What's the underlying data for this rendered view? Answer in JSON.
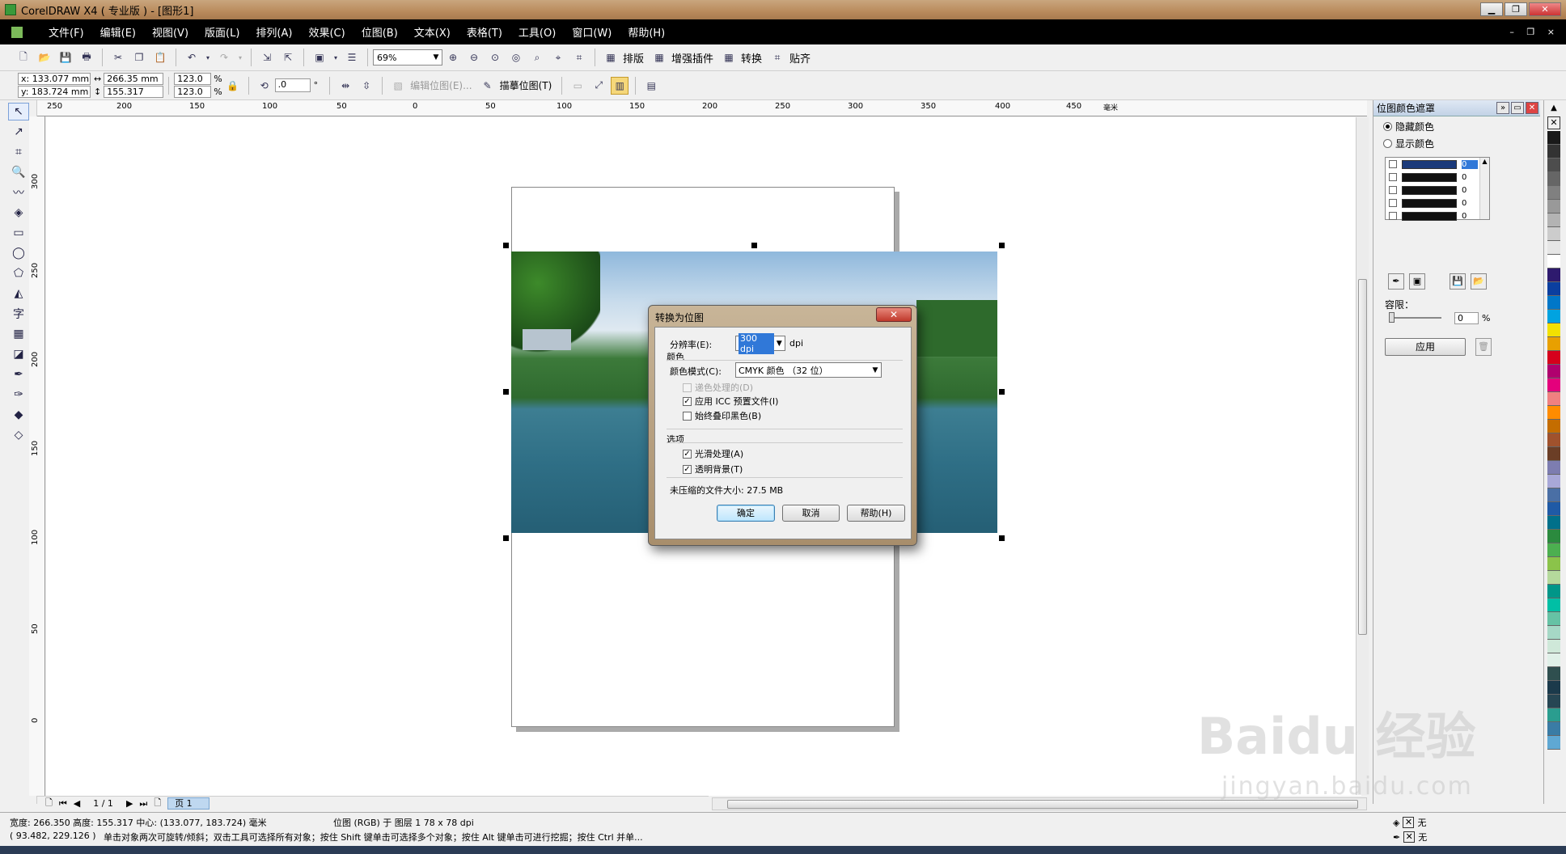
{
  "window": {
    "title": "CorelDRAW X4 ( 专业版 ) - [图形1]",
    "min": "▁",
    "max": "❐",
    "close": "✕"
  },
  "menu": {
    "items": [
      "文件(F)",
      "编辑(E)",
      "视图(V)",
      "版面(L)",
      "排列(A)",
      "效果(C)",
      "位图(B)",
      "文本(X)",
      "表格(T)",
      "工具(O)",
      "窗口(W)",
      "帮助(H)"
    ],
    "doc_controls": "– ❐ ×"
  },
  "toolbar1": {
    "zoom": "69%",
    "layout_label": "排版",
    "plugin_label": "增强插件",
    "convert_label": "转换",
    "snap_label": "贴齐"
  },
  "toolbar2": {
    "x": "x: 133.077 mm",
    "y": "y: 183.724 mm",
    "width": "266.35 mm",
    "height": "155.317 mm",
    "scale_x": "123.0",
    "scale_y": "123.0",
    "pct": "%",
    "rotation": ".0",
    "deg": "°",
    "edit_bitmap": "编辑位图(E)...",
    "trace_bitmap": "描摹位图(T)"
  },
  "ruler": {
    "h_ticks": [
      "250",
      "200",
      "150",
      "100",
      "50",
      "0",
      "50",
      "100",
      "150",
      "200",
      "250",
      "300",
      "350",
      "400",
      "450"
    ],
    "h_unit": "毫米",
    "v_ticks": [
      "300",
      "250",
      "200",
      "150",
      "100",
      "50",
      "0"
    ]
  },
  "page_nav": {
    "count": "1 / 1",
    "tab": "页 1"
  },
  "docker": {
    "title": "位图颜色遮罩",
    "hide_color": "隐藏颜色",
    "show_color": "显示颜色",
    "rows": [
      {
        "value": "0",
        "selected": true
      },
      {
        "value": "0",
        "selected": false
      },
      {
        "value": "0",
        "selected": false
      },
      {
        "value": "0",
        "selected": false
      },
      {
        "value": "0",
        "selected": false
      }
    ],
    "tolerance_label": "容限：",
    "tolerance_value": "0",
    "tolerance_unit": "%",
    "tolerance_level": 0,
    "apply": "应用"
  },
  "dialog": {
    "title": "转换为位图",
    "resolution_label": "分辨率(E):",
    "resolution_value": "300 dpi",
    "resolution_unit": "dpi",
    "color_group": "颜色",
    "color_mode_label": "颜色模式(C):",
    "color_mode_value": "CMYK 颜色 （32 位）",
    "dither": "递色处理的(D)",
    "dither_checked": false,
    "apply_icc": "应用 ICC 预置文件(I)",
    "apply_icc_checked": true,
    "overprint_black": "始终叠印黑色(B)",
    "overprint_black_checked": false,
    "options_group": "选项",
    "antialias": "光滑处理(A)",
    "antialias_checked": true,
    "transparent_bg": "透明背景(T)",
    "transparent_bg_checked": true,
    "filesize": "未压缩的文件大小: 27.5 MB",
    "ok": "确定",
    "cancel": "取消",
    "help": "帮助(H)"
  },
  "status": {
    "dims": "宽度: 266.350  高度: 155.317  中心: (133.077, 183.724)  毫米",
    "object": "位图 (RGB) 于 图层 1 78 x 78 dpi",
    "cursor": "( 93.482, 229.126 )",
    "hint": "单击对象两次可旋转/倾斜；双击工具可选择所有对象；按住 Shift 键单击可选择多个对象；按住 Alt 键单击可进行挖掘；按住 Ctrl 并单...",
    "fill": "无",
    "outline": "无"
  },
  "watermark": {
    "brand": "Baidu 经验",
    "url": "jingyan.baidu.com"
  },
  "colors": {
    "palette": [
      "#1a1a1a",
      "#333333",
      "#4d4d4d",
      "#666666",
      "#808080",
      "#999999",
      "#b3b3b3",
      "#cccccc",
      "#e6e6e6",
      "#ffffff",
      "#2e1a6e",
      "#0b3fa0",
      "#0077c8",
      "#00a3e0",
      "#f2e100",
      "#e8a000",
      "#d6001c",
      "#b0006e",
      "#e4007c",
      "#f08080",
      "#ff8c00",
      "#c46d00",
      "#a0522d",
      "#6b3e26",
      "#7d7db0",
      "#a8a8d8",
      "#4a6fa5",
      "#1f5aa6",
      "#00708a",
      "#2b8a3e",
      "#4caf50",
      "#8bc34a",
      "#b5d99c",
      "#009688",
      "#00bfa5",
      "#66c2a5",
      "#a6d8c6",
      "#cfe8d9",
      "#e0f0e8",
      "#2f4f4f",
      "#1b3a4b",
      "#264653",
      "#2a9d8f",
      "#3a7ca5",
      "#5fa8d3"
    ]
  }
}
